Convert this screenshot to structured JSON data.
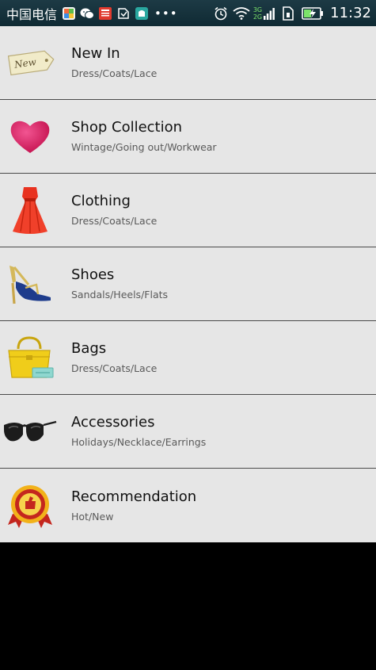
{
  "status_bar": {
    "carrier": "中国电信",
    "notification_icons": [
      "app-icon",
      "wechat-icon",
      "news-icon",
      "cleaner-icon",
      "store-icon"
    ],
    "more": "•••",
    "network_top": "3G",
    "network_bottom": "2G",
    "time": "11:32"
  },
  "colors": {
    "status_bar": "#133440",
    "list_bg": "#e6e6e6",
    "divider": "#4a4a4a",
    "network_label": "#7ce36a"
  },
  "menu": {
    "items": [
      {
        "title": "New In",
        "subtitle": "Dress/Coats/Lace",
        "icon": "new-tag-icon"
      },
      {
        "title": "Shop Collection",
        "subtitle": "Wintage/Going out/Workwear",
        "icon": "heart-icon"
      },
      {
        "title": "Clothing",
        "subtitle": "Dress/Coats/Lace",
        "icon": "dress-icon"
      },
      {
        "title": "Shoes",
        "subtitle": "Sandals/Heels/Flats",
        "icon": "high-heel-icon"
      },
      {
        "title": "Bags",
        "subtitle": "Dress/Coats/Lace",
        "icon": "handbag-icon"
      },
      {
        "title": "Accessories",
        "subtitle": "Holidays/Necklace/Earrings",
        "icon": "sunglasses-icon"
      },
      {
        "title": "Recommendation",
        "subtitle": "Hot/New",
        "icon": "badge-icon"
      }
    ]
  }
}
